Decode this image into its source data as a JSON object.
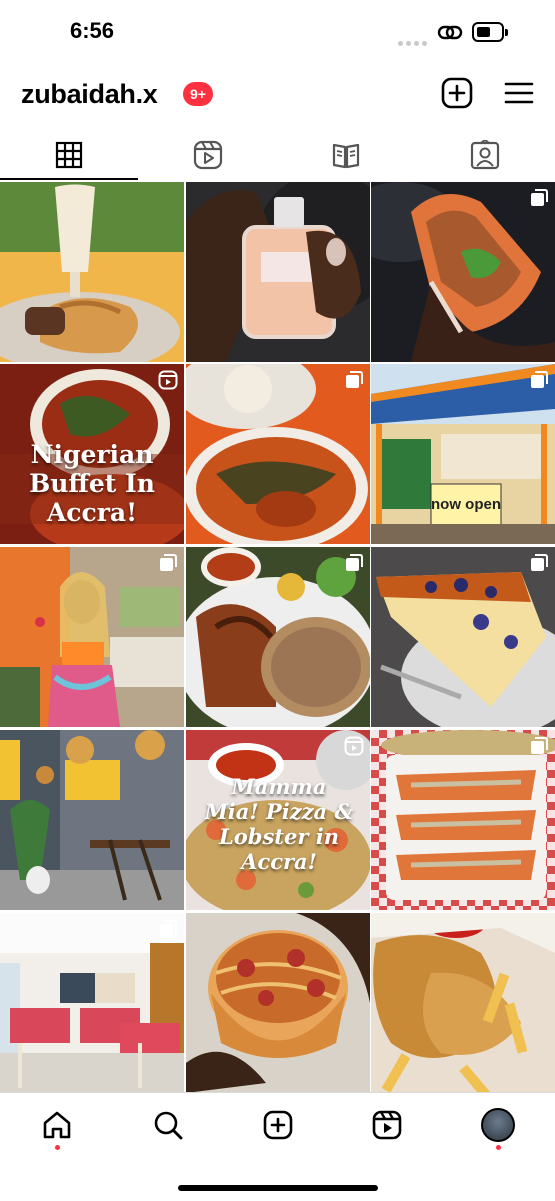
{
  "status_bar": {
    "time": "6:56"
  },
  "profile": {
    "username": "zubaidah.x",
    "notification_count": "9+"
  },
  "header_icons": [
    "new-post-icon",
    "menu-icon"
  ],
  "tabs": [
    {
      "icon": "grid-icon",
      "active": true
    },
    {
      "icon": "reels-icon",
      "active": false
    },
    {
      "icon": "guide-icon",
      "active": false
    },
    {
      "icon": "tagged-icon",
      "active": false
    }
  ],
  "posts": [
    {
      "subject": "french toast and milkshake",
      "badge": "none"
    },
    {
      "subject": "perfume bottle",
      "badge": "none"
    },
    {
      "subject": "shawarma wrap",
      "badge": "carousel"
    },
    {
      "subject": "stew",
      "badge": "reel",
      "overlay": "Nigerian Buffet In Accra!"
    },
    {
      "subject": "soup bowl",
      "badge": "carousel"
    },
    {
      "subject": "restaurant storefront",
      "badge": "carousel",
      "sign_text": "now open"
    },
    {
      "subject": "woman with drink",
      "badge": "carousel"
    },
    {
      "subject": "grilled chicken and rice",
      "badge": "carousel"
    },
    {
      "subject": "blueberry cheesecake",
      "badge": "carousel"
    },
    {
      "subject": "restaurant interior",
      "badge": "none"
    },
    {
      "subject": "pizza and lobster",
      "badge": "reel",
      "overlay": "Mamma Mia! Pizza & Lobster in Accra!"
    },
    {
      "subject": "lobster platter",
      "badge": "carousel"
    },
    {
      "subject": "dining room",
      "badge": "carousel"
    },
    {
      "subject": "spaghetti bowl",
      "badge": "none"
    },
    {
      "subject": "fried fish and chips",
      "badge": "none"
    }
  ],
  "bottom_nav": [
    {
      "icon": "home-icon",
      "dot": true
    },
    {
      "icon": "search-icon",
      "dot": false
    },
    {
      "icon": "create-icon",
      "dot": false
    },
    {
      "icon": "reels-icon",
      "dot": false
    },
    {
      "icon": "profile-avatar",
      "dot": true
    }
  ],
  "colors": {
    "accent": "#ff3040"
  }
}
